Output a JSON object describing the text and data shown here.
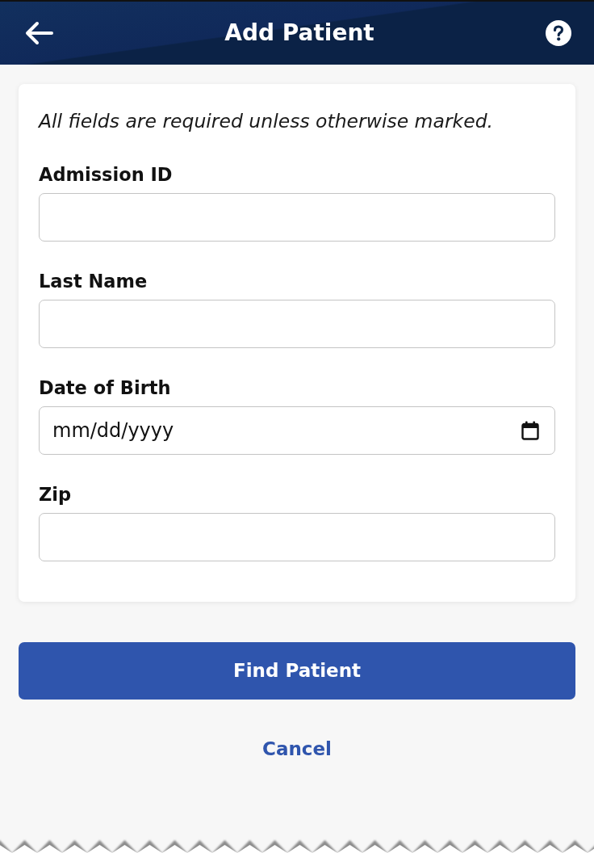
{
  "header": {
    "title": "Add Patient"
  },
  "form": {
    "note": "All fields are required unless otherwise marked.",
    "fields": [
      {
        "label": "Admission ID",
        "kind": "text"
      },
      {
        "label": "Last Name",
        "kind": "text"
      },
      {
        "label": "Date of Birth",
        "kind": "date",
        "placeholder": "mm/dd/yyyy"
      },
      {
        "label": "Zip",
        "kind": "text"
      }
    ]
  },
  "actions": {
    "primary": "Find Patient",
    "secondary": "Cancel"
  }
}
